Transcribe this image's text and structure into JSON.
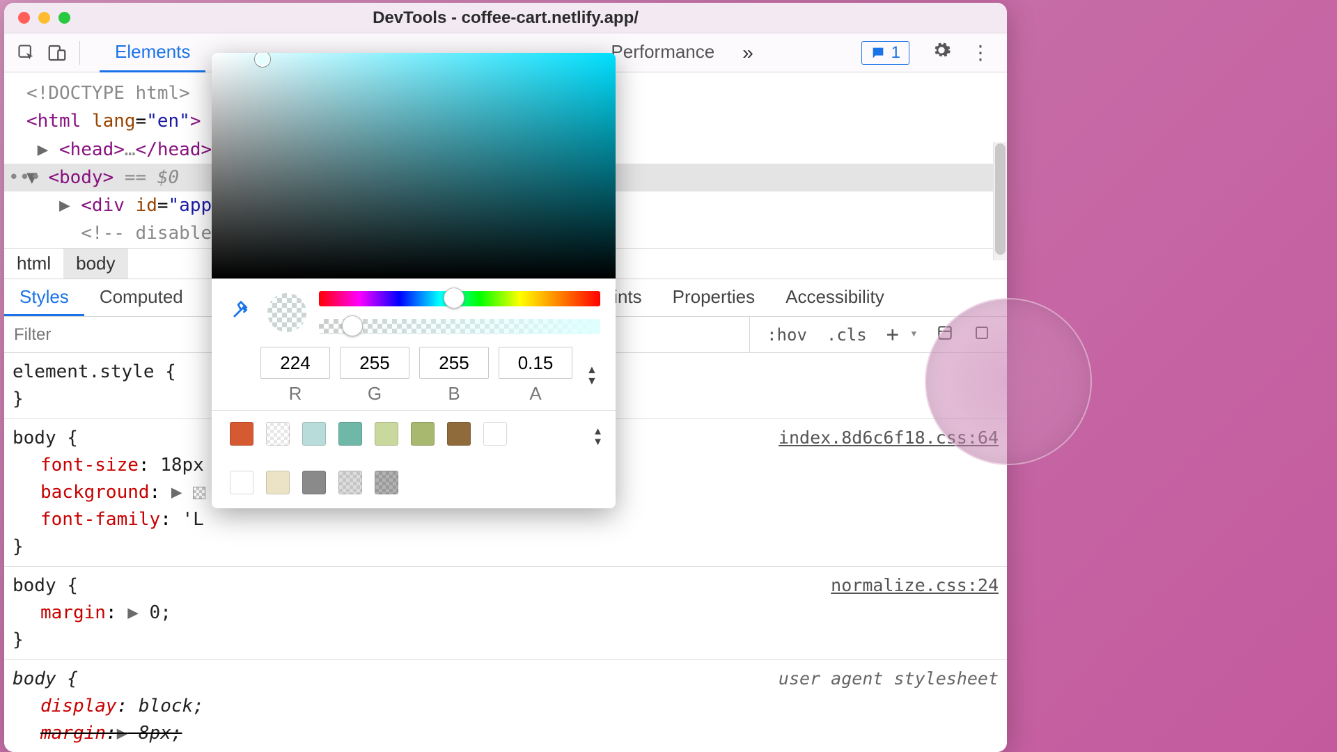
{
  "window": {
    "title": "DevTools - coffee-cart.netlify.app/"
  },
  "toolbar": {
    "tabs": [
      "Elements",
      "Performance"
    ],
    "active_tab": 0,
    "issues_count": "1"
  },
  "dom": {
    "doctype": "<!DOCTYPE html>",
    "html_open": "<html lang=\"en\">",
    "head": "<head>…</head>",
    "body_sel": "<body> == $0",
    "div_app": "<div id=\"app\"",
    "comment": "<!-- disable",
    "comment_tail": ">"
  },
  "crumbs": [
    "html",
    "body"
  ],
  "sidetabs": {
    "items": [
      "Styles",
      "Computed",
      "akpoints",
      "Properties",
      "Accessibility"
    ],
    "active": 0
  },
  "filter": {
    "placeholder": "Filter",
    "tools": {
      "hov": ":hov",
      "cls": ".cls",
      "plus": "+"
    }
  },
  "rules": {
    "element_style": {
      "sel": "element.style {",
      "close": "}"
    },
    "r1": {
      "sel": "body {",
      "src": "index.8d6c6f18.css:64",
      "p1_prop": "font-size",
      "p1_val": "18px",
      "p2_prop": "background",
      "p3_prop": "font-family",
      "p3_val": "'L",
      "close": "}"
    },
    "r2": {
      "sel": "body {",
      "src": "normalize.css:24",
      "p1_prop": "margin",
      "p1_val": "0;",
      "close": "}"
    },
    "r3": {
      "sel": "body {",
      "src": "user agent stylesheet",
      "p1_prop": "display",
      "p1_val": "block;",
      "p2_prop": "margin",
      "p2_val": "8px;",
      "close": "}"
    }
  },
  "picker": {
    "rgba": {
      "r": "224",
      "g": "255",
      "b": "255",
      "a": "0.15"
    },
    "labels": {
      "r": "R",
      "g": "G",
      "b": "B",
      "a": "A"
    },
    "hue_pos_pct": 48,
    "alpha_pos_pct": 12,
    "swatches_row1": [
      "#d65a31",
      "checker:#ffffff",
      "#b7dcd9",
      "#6fb8a8",
      "#c9d89c",
      "#a8b86f",
      "#8f6b3c",
      "#ffffff"
    ],
    "swatches_row2": [
      "#ffffff",
      "#ece3c6",
      "#8a8a8a",
      "checker:#bfbfbf",
      "checker:#6f6f6f"
    ]
  }
}
